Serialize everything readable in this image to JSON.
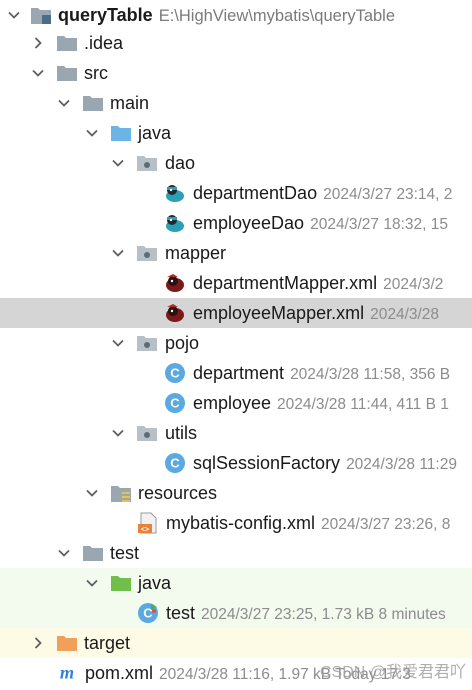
{
  "project": {
    "name": "queryTable",
    "path": "E:\\HighView\\mybatis\\queryTable"
  },
  "nodes": [
    {
      "id": "idea",
      "name": ".idea",
      "meta": ""
    },
    {
      "id": "src",
      "name": "src",
      "meta": ""
    },
    {
      "id": "main",
      "name": "main",
      "meta": ""
    },
    {
      "id": "java-main",
      "name": "java",
      "meta": ""
    },
    {
      "id": "dao",
      "name": "dao",
      "meta": ""
    },
    {
      "id": "departmentDao",
      "name": "departmentDao",
      "meta": "2024/3/27 23:14, 2"
    },
    {
      "id": "employeeDao",
      "name": "employeeDao",
      "meta": "2024/3/27 18:32, 15"
    },
    {
      "id": "mapper",
      "name": "mapper",
      "meta": ""
    },
    {
      "id": "departmentMapper",
      "name": "departmentMapper.xml",
      "meta": "2024/3/2"
    },
    {
      "id": "employeeMapper",
      "name": "employeeMapper.xml",
      "meta": "2024/3/28"
    },
    {
      "id": "pojo",
      "name": "pojo",
      "meta": ""
    },
    {
      "id": "department",
      "name": "department",
      "meta": "2024/3/28 11:58, 356 B"
    },
    {
      "id": "employee",
      "name": "employee",
      "meta": "2024/3/28 11:44, 411 B 1"
    },
    {
      "id": "utils",
      "name": "utils",
      "meta": ""
    },
    {
      "id": "sqlSessionFactory",
      "name": "sqlSessionFactory",
      "meta": "2024/3/28 11:29"
    },
    {
      "id": "resources",
      "name": "resources",
      "meta": ""
    },
    {
      "id": "mybatis-config",
      "name": "mybatis-config.xml",
      "meta": "2024/3/27 23:26, 8"
    },
    {
      "id": "test",
      "name": "test",
      "meta": ""
    },
    {
      "id": "java-test",
      "name": "java",
      "meta": ""
    },
    {
      "id": "test-class",
      "name": "test",
      "meta": "2024/3/27 23:25, 1.73 kB 8 minutes"
    },
    {
      "id": "target",
      "name": "target",
      "meta": ""
    },
    {
      "id": "pom",
      "name": "pom.xml",
      "meta": "2024/3/28 11:16, 1.97 kB Today 17:3"
    }
  ],
  "watermark": "CSDN @我爱君君吖",
  "colors": {
    "selection": "#d5d5d5",
    "folder": "#9aa7b0",
    "source_folder": "#6cb4e6",
    "test_folder": "#6fbf4a",
    "excluded_folder": "#f0a05a",
    "class_icon": "#5aa9e0",
    "maven": "#2f84d8"
  },
  "icons": {
    "project": "project-module-icon",
    "folder": "folder-icon",
    "package": "package-icon",
    "mybatis": "mybatis-bird-icon",
    "class": "class-icon",
    "xml": "xml-file-icon",
    "maven": "maven-m-icon"
  }
}
